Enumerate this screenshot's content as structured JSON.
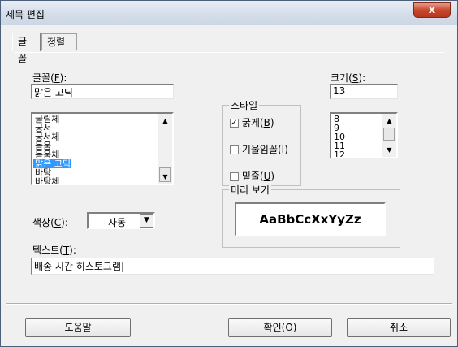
{
  "window": {
    "title": "제목 편집",
    "close_label": "x"
  },
  "tabs": [
    {
      "label": "글꼴"
    },
    {
      "label": "정렬"
    }
  ],
  "font": {
    "label": "글꼴(F):",
    "value": "맑은 고딕",
    "list": [
      "굴림체",
      "궁서",
      "궁서체",
      "돋움",
      "돋움체",
      "맑은 고딕",
      "바탕",
      "바탕체"
    ],
    "selected_index": 5
  },
  "style": {
    "group_label": "스타일",
    "bold_label": "굵게(B)",
    "bold_checked": true,
    "italic_label": "기울임꼴(I)",
    "italic_checked": false,
    "underline_label": "밑줄(U)",
    "underline_checked": false
  },
  "size": {
    "label": "크기(S):",
    "value": "13",
    "list": [
      "8",
      "9",
      "10",
      "11",
      "12"
    ]
  },
  "preview": {
    "group_label": "미리 보기",
    "sample_text": "AaBbCcXxYyZz"
  },
  "color": {
    "label": "색상(C):",
    "value": "자동"
  },
  "text": {
    "label": "텍스트(T):",
    "value": "배송 시간 히스토그램"
  },
  "buttons": {
    "help": "도움말",
    "ok": "확인(O)",
    "cancel": "취소"
  },
  "icons": {
    "scroll_up": "scroll-up-icon",
    "scroll_down": "scroll-down-icon",
    "dropdown": "chevron-down-icon",
    "check": "check-icon"
  }
}
